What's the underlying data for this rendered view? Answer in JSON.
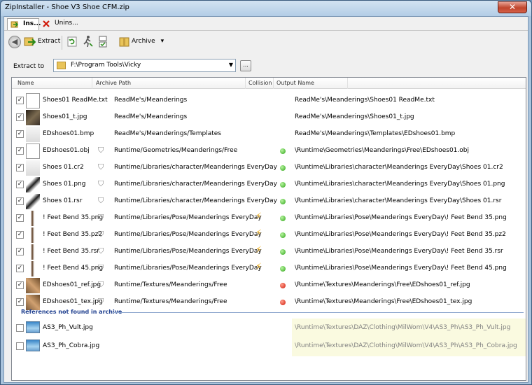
{
  "window": {
    "title": "ZipInstaller - Shoe V3 Shoe CFM.zip",
    "close_glyph": "✕"
  },
  "tabs": [
    {
      "label": "Ins..."
    },
    {
      "label": "Unins..."
    }
  ],
  "toolbar": {
    "back_glyph": "◀",
    "extract_label": "Extract",
    "archive_label": "Archive",
    "archive_arrow": "▾"
  },
  "extract_to": {
    "label": "Extract to",
    "path": "F:\\Program Tools\\Vicky",
    "browse_label": "..."
  },
  "columns": {
    "name": "Name",
    "archive_path": "Archive Path",
    "collision": "Collision",
    "output_name": "Output Name"
  },
  "rows": [
    {
      "file": "Shoes01 ReadMe.txt",
      "archive_path": "ReadMe's/Meanderings",
      "output": "ReadMe's\\Meanderings\\Shoes01 ReadMe.txt",
      "thumb": "document-icon",
      "runtime": false,
      "collision": false,
      "status": ""
    },
    {
      "file": "Shoes01_t.jpg",
      "archive_path": "ReadMe's/Meanderings",
      "output": "ReadMe's\\Meanderings\\Shoes01_t.jpg",
      "thumb": "shoe-photo-icon",
      "runtime": false,
      "collision": false,
      "status": ""
    },
    {
      "file": "EDshoes01.bmp",
      "archive_path": "ReadMe's/Meanderings/Templates",
      "output": "ReadMe's\\Meanderings\\Templates\\EDshoes01.bmp",
      "thumb": "template-icon",
      "runtime": false,
      "collision": false,
      "status": ""
    },
    {
      "file": "EDshoes01.obj",
      "archive_path": "Runtime/Geometries/Meanderings/Free",
      "output": "\\Runtime\\Geometries\\Meanderings\\Free\\EDshoes01.obj",
      "thumb": "document-icon",
      "runtime": true,
      "collision": false,
      "status": "green"
    },
    {
      "file": "Shoes 01.cr2",
      "archive_path": "Runtime/Libraries/character/Meanderings EveryDay",
      "output": "\\Runtime\\Libraries\\character\\Meanderings EveryDay\\Shoes 01.cr2",
      "thumb": "figure-icon",
      "runtime": true,
      "collision": false,
      "status": "green"
    },
    {
      "file": "Shoes 01.png",
      "archive_path": "Runtime/Libraries/character/Meanderings EveryDay",
      "output": "\\Runtime\\Libraries\\character\\Meanderings EveryDay\\Shoes 01.png",
      "thumb": "heel-icon",
      "runtime": true,
      "collision": false,
      "status": "green"
    },
    {
      "file": "Shoes 01.rsr",
      "archive_path": "Runtime/Libraries/character/Meanderings EveryDay",
      "output": "\\Runtime\\Libraries\\character\\Meanderings EveryDay\\Shoes 01.rsr",
      "thumb": "heel-icon",
      "runtime": true,
      "collision": false,
      "status": "green"
    },
    {
      "file": "! Feet Bend 35.png",
      "archive_path": "Runtime/Libraries/Pose/Meanderings EveryDay",
      "output": "\\Runtime\\Libraries\\Pose\\Meanderings EveryDay\\! Feet Bend 35.png",
      "thumb": "pose-icon",
      "runtime": true,
      "collision": true,
      "status": "green"
    },
    {
      "file": "! Feet Bend 35.pz2",
      "archive_path": "Runtime/Libraries/Pose/Meanderings EveryDay",
      "output": "\\Runtime\\Libraries\\Pose\\Meanderings EveryDay\\! Feet Bend 35.pz2",
      "thumb": "pose-icon",
      "runtime": true,
      "collision": true,
      "status": "green"
    },
    {
      "file": "! Feet Bend 35.rsr",
      "archive_path": "Runtime/Libraries/Pose/Meanderings EveryDay",
      "output": "\\Runtime\\Libraries\\Pose\\Meanderings EveryDay\\! Feet Bend 35.rsr",
      "thumb": "pose-icon",
      "runtime": true,
      "collision": true,
      "status": "green"
    },
    {
      "file": "! Feet Bend 45.png",
      "archive_path": "Runtime/Libraries/Pose/Meanderings EveryDay",
      "output": "\\Runtime\\Libraries\\Pose\\Meanderings EveryDay\\! Feet Bend 45.png",
      "thumb": "pose-icon",
      "runtime": true,
      "collision": true,
      "status": "green"
    },
    {
      "file": "EDshoes01_ref.jpg",
      "archive_path": "Runtime/Textures/Meanderings/Free",
      "output": "\\Runtime\\Textures\\Meanderings\\Free\\EDshoes01_ref.jpg",
      "thumb": "texture-icon",
      "runtime": true,
      "collision": false,
      "status": "red"
    },
    {
      "file": "EDshoes01_tex.jpg",
      "archive_path": "Runtime/Textures/Meanderings/Free",
      "output": "\\Runtime\\Textures\\Meanderings\\Free\\EDshoes01_tex.jpg",
      "thumb": "texture-icon",
      "runtime": true,
      "collision": false,
      "status": "red"
    }
  ],
  "missing": {
    "header": "References not found in archive",
    "rows": [
      {
        "file": "AS3_Ph_Vult.jpg",
        "output": "\\Runtime\\Textures\\DAZ\\Clothing\\MilWom\\V4\\AS3_Ph\\AS3_Ph_Vult.jpg"
      },
      {
        "file": "AS3_Ph_Cobra.jpg",
        "output": "\\Runtime\\Textures\\DAZ\\Clothing\\MilWom\\V4\\AS3_Ph\\AS3_Ph_Cobra.jpg"
      }
    ]
  },
  "colors": {
    "ok": "#2fa41a",
    "error": "#d01a0a",
    "group_header": "#1f3f8f",
    "missing_bg": "#fafae0"
  }
}
